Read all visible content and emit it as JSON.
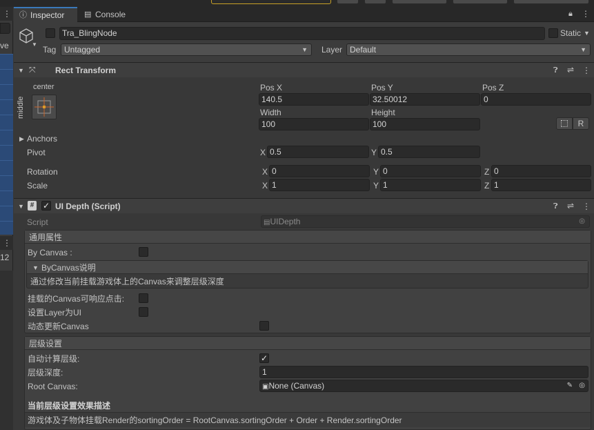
{
  "tabs": {
    "inspector": "Inspector",
    "console": "Console"
  },
  "left_panel": {
    "edge_text_1": "ve",
    "edge_text_2": "12"
  },
  "gameobject": {
    "name": "Tra_BlingNode",
    "static_label": "Static",
    "tag_label": "Tag",
    "tag_value": "Untagged",
    "layer_label": "Layer",
    "layer_value": "Default"
  },
  "rect_transform": {
    "title": "Rect Transform",
    "anchor_preset": {
      "top": "center",
      "side": "middle"
    },
    "pos_x_label": "Pos X",
    "pos_y_label": "Pos Y",
    "pos_z_label": "Pos Z",
    "pos_x": "140.5",
    "pos_y": "32.50012",
    "pos_z": "0",
    "width_label": "Width",
    "height_label": "Height",
    "width": "100",
    "height": "100",
    "r_button": "R",
    "anchors_label": "Anchors",
    "pivot_label": "Pivot",
    "pivot_x": "0.5",
    "pivot_y": "0.5",
    "rotation_label": "Rotation",
    "rot_x": "0",
    "rot_y": "0",
    "rot_z": "0",
    "scale_label": "Scale",
    "scale_x": "1",
    "scale_y": "1",
    "scale_z": "1",
    "axis_x": "X",
    "axis_y": "Y",
    "axis_z": "Z"
  },
  "ui_depth": {
    "title": "UI Depth (Script)",
    "script_label": "Script",
    "script_value": "UIDepth",
    "general_header": "通用属性",
    "by_canvas_label": "By Canvas :",
    "by_canvas_foldout": "ByCanvas说明",
    "by_canvas_desc": "通过修改当前挂载游戏体上的Canvas来调整层级深度",
    "canvas_click_label": "挂载的Canvas可响应点击:",
    "layer_ui_label": "设置Layer为UI",
    "dynamic_update_label": "动态更新Canvas",
    "level_header": "层级设置",
    "auto_calc_label": "自动计算层级:",
    "auto_calc_checked": "✓",
    "depth_label": "层级深度:",
    "depth_value": "1",
    "root_canvas_label": "Root Canvas:",
    "root_canvas_value": "None (Canvas)",
    "effect_title": "当前层级设置效果描述",
    "effect_desc": "游戏体及子物体挂载Render的sortingOrder  = RootCanvas.sortingOrder + Order + Render.sortingOrder"
  }
}
